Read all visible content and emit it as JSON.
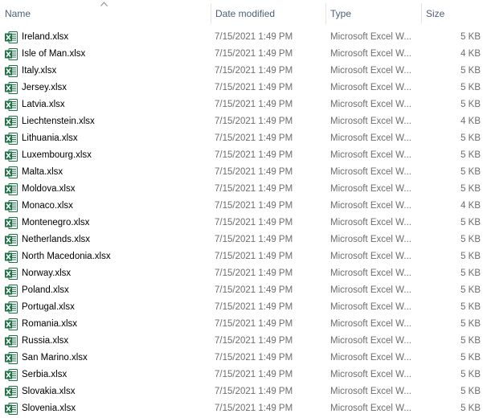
{
  "columns": {
    "name": "Name",
    "date": "Date modified",
    "type": "Type",
    "size": "Size"
  },
  "sort": {
    "column": "name",
    "direction": "ascending"
  },
  "files": [
    {
      "name": "Ireland.xlsx",
      "date": "7/15/2021 1:49 PM",
      "type": "Microsoft Excel W...",
      "size": "5 KB"
    },
    {
      "name": "Isle of Man.xlsx",
      "date": "7/15/2021 1:49 PM",
      "type": "Microsoft Excel W...",
      "size": "4 KB"
    },
    {
      "name": "Italy.xlsx",
      "date": "7/15/2021 1:49 PM",
      "type": "Microsoft Excel W...",
      "size": "5 KB"
    },
    {
      "name": "Jersey.xlsx",
      "date": "7/15/2021 1:49 PM",
      "type": "Microsoft Excel W...",
      "size": "5 KB"
    },
    {
      "name": "Latvia.xlsx",
      "date": "7/15/2021 1:49 PM",
      "type": "Microsoft Excel W...",
      "size": "5 KB"
    },
    {
      "name": "Liechtenstein.xlsx",
      "date": "7/15/2021 1:49 PM",
      "type": "Microsoft Excel W...",
      "size": "4 KB"
    },
    {
      "name": "Lithuania.xlsx",
      "date": "7/15/2021 1:49 PM",
      "type": "Microsoft Excel W...",
      "size": "5 KB"
    },
    {
      "name": "Luxembourg.xlsx",
      "date": "7/15/2021 1:49 PM",
      "type": "Microsoft Excel W...",
      "size": "5 KB"
    },
    {
      "name": "Malta.xlsx",
      "date": "7/15/2021 1:49 PM",
      "type": "Microsoft Excel W...",
      "size": "5 KB"
    },
    {
      "name": "Moldova.xlsx",
      "date": "7/15/2021 1:49 PM",
      "type": "Microsoft Excel W...",
      "size": "5 KB"
    },
    {
      "name": "Monaco.xlsx",
      "date": "7/15/2021 1:49 PM",
      "type": "Microsoft Excel W...",
      "size": "4 KB"
    },
    {
      "name": "Montenegro.xlsx",
      "date": "7/15/2021 1:49 PM",
      "type": "Microsoft Excel W...",
      "size": "5 KB"
    },
    {
      "name": "Netherlands.xlsx",
      "date": "7/15/2021 1:49 PM",
      "type": "Microsoft Excel W...",
      "size": "5 KB"
    },
    {
      "name": "North Macedonia.xlsx",
      "date": "7/15/2021 1:49 PM",
      "type": "Microsoft Excel W...",
      "size": "5 KB"
    },
    {
      "name": "Norway.xlsx",
      "date": "7/15/2021 1:49 PM",
      "type": "Microsoft Excel W...",
      "size": "5 KB"
    },
    {
      "name": "Poland.xlsx",
      "date": "7/15/2021 1:49 PM",
      "type": "Microsoft Excel W...",
      "size": "5 KB"
    },
    {
      "name": "Portugal.xlsx",
      "date": "7/15/2021 1:49 PM",
      "type": "Microsoft Excel W...",
      "size": "5 KB"
    },
    {
      "name": "Romania.xlsx",
      "date": "7/15/2021 1:49 PM",
      "type": "Microsoft Excel W...",
      "size": "5 KB"
    },
    {
      "name": "Russia.xlsx",
      "date": "7/15/2021 1:49 PM",
      "type": "Microsoft Excel W...",
      "size": "5 KB"
    },
    {
      "name": "San Marino.xlsx",
      "date": "7/15/2021 1:49 PM",
      "type": "Microsoft Excel W...",
      "size": "5 KB"
    },
    {
      "name": "Serbia.xlsx",
      "date": "7/15/2021 1:49 PM",
      "type": "Microsoft Excel W...",
      "size": "5 KB"
    },
    {
      "name": "Slovakia.xlsx",
      "date": "7/15/2021 1:49 PM",
      "type": "Microsoft Excel W...",
      "size": "5 KB"
    },
    {
      "name": "Slovenia.xlsx",
      "date": "7/15/2021 1:49 PM",
      "type": "Microsoft Excel W...",
      "size": "5 KB"
    }
  ],
  "icon": "excel-file-icon",
  "colors": {
    "excel_green": "#1e7145",
    "header_text": "#4c607a",
    "detail_text": "#6d6d6d"
  }
}
